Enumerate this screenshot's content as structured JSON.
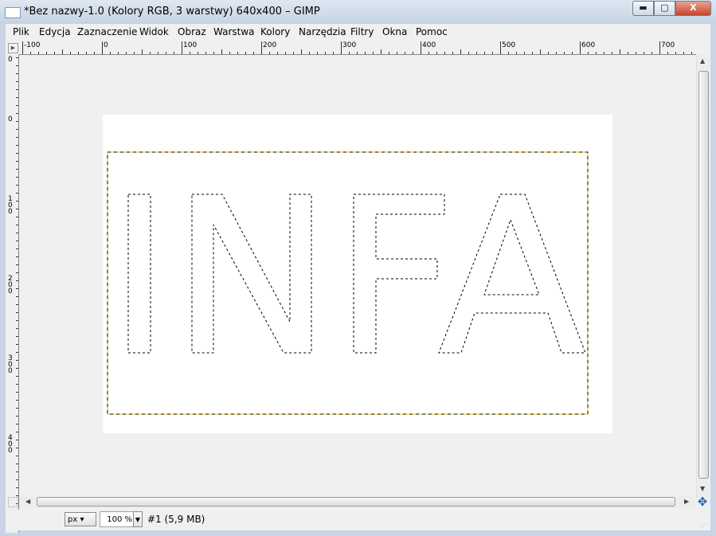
{
  "window": {
    "title": "*Bez nazwy-1.0 (Kolory RGB, 3 warstwy) 640x400 – GIMP",
    "minimize_glyph": "▬",
    "maximize_glyph": "▢",
    "close_glyph": "X"
  },
  "menu": {
    "items": [
      "Plik",
      "Edycja",
      "Zaznaczenie",
      "Widok",
      "Obraz",
      "Warstwa",
      "Kolory",
      "Narzędzia",
      "Filtry",
      "Okna",
      "Pomoc"
    ]
  },
  "rulers": {
    "horizontal_labels": [
      "-100",
      "0",
      "100",
      "200",
      "300",
      "400",
      "500",
      "600",
      "700"
    ],
    "vertical_labels": [
      "0",
      "0",
      "100",
      "200",
      "300",
      "400"
    ]
  },
  "image": {
    "text": "INFA",
    "selection_color": "#000000",
    "layer_boundary_color": "#e8c000"
  },
  "status": {
    "unit": "px",
    "zoom": "100 %",
    "info": "#1 (5,9 MB)"
  },
  "icons": {
    "navigate": "move-icon",
    "menu_arrow": "menu-arrow-icon",
    "quick_mask": "quick-mask-icon"
  }
}
